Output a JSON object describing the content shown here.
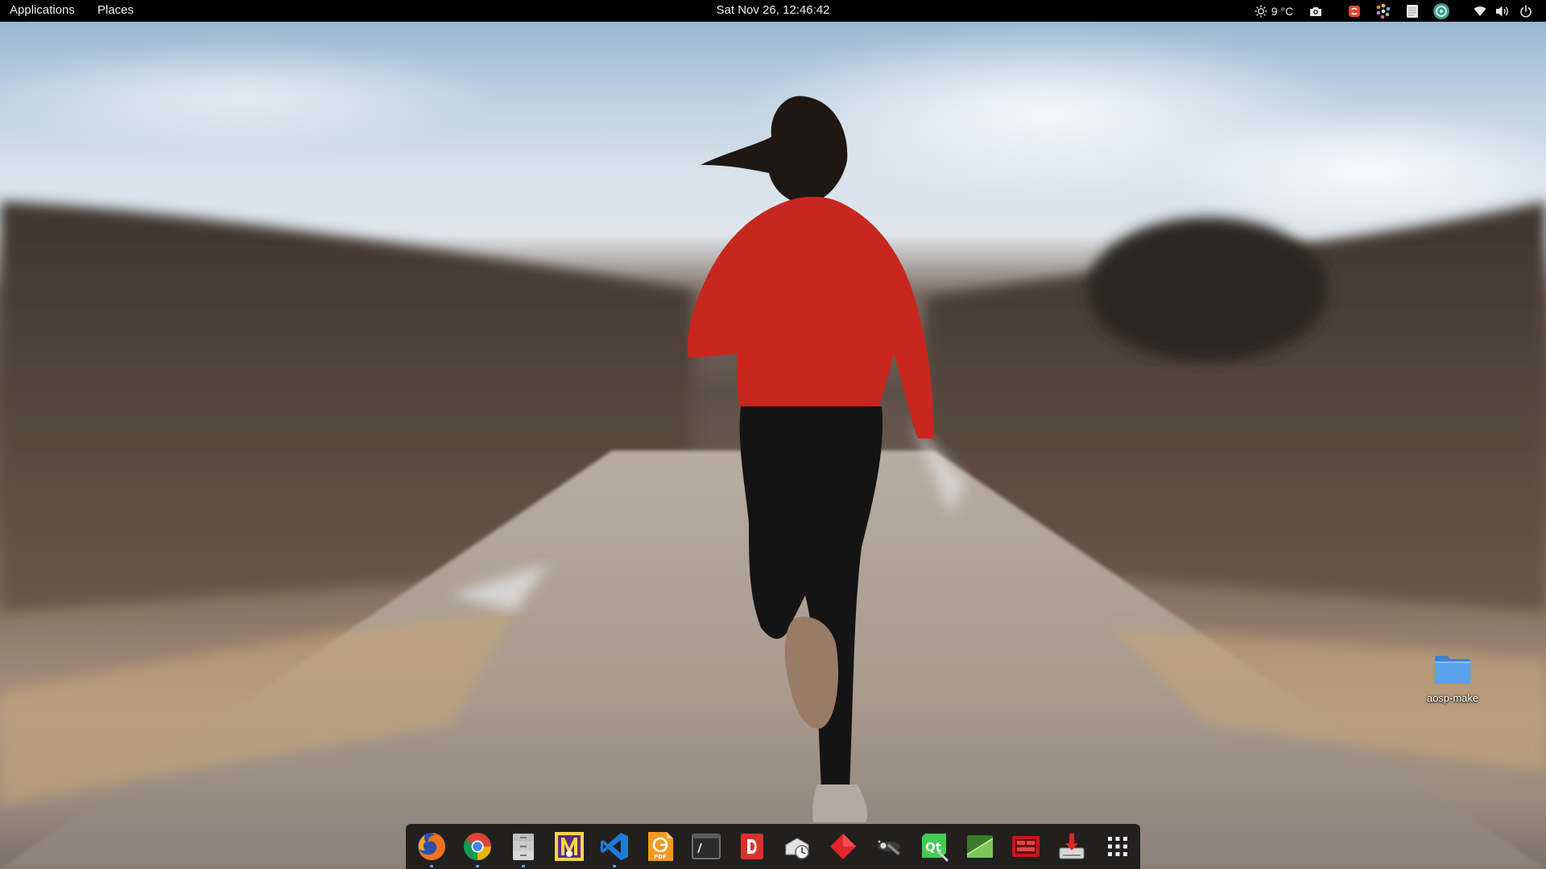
{
  "topbar": {
    "applications_label": "Applications",
    "places_label": "Places",
    "clock": "Sat Nov 26, 12:46:42",
    "weather": "9 °C"
  },
  "desktop": {
    "icons": [
      {
        "label": "aosp-make",
        "icon": "folder-icon"
      }
    ]
  },
  "dock": {
    "items": [
      {
        "name": "firefox",
        "icon": "firefox-icon",
        "running": true
      },
      {
        "name": "chrome",
        "icon": "chrome-icon",
        "running": true
      },
      {
        "name": "files",
        "icon": "files-icon",
        "running": true
      },
      {
        "name": "latex-editor",
        "icon": "latex-editor-icon",
        "running": false
      },
      {
        "name": "vscode",
        "icon": "vscode-icon",
        "running": true
      },
      {
        "name": "pdf-editor",
        "icon": "pdf-editor-icon",
        "running": false
      },
      {
        "name": "terminal",
        "icon": "terminal-icon",
        "running": false
      },
      {
        "name": "dict",
        "icon": "dict-icon",
        "running": false
      },
      {
        "name": "disk-usage",
        "icon": "disk-usage-icon",
        "running": false
      },
      {
        "name": "git-gui",
        "icon": "diamond-app-icon",
        "running": false
      },
      {
        "name": "tweak-tool",
        "icon": "tweak-tool-icon",
        "running": false
      },
      {
        "name": "qt-creator",
        "icon": "qt-creator-icon",
        "running": false
      },
      {
        "name": "system-monitor",
        "icon": "system-monitor-icon",
        "running": false
      },
      {
        "name": "presenter",
        "icon": "presenter-icon",
        "running": false
      },
      {
        "name": "installer",
        "icon": "installer-icon",
        "running": false
      },
      {
        "name": "show-applications",
        "icon": "app-grid-icon",
        "running": false
      }
    ]
  },
  "colors": {
    "topbar_bg": "#000000",
    "dock_bg": "#121212",
    "running_indicator": "#5fa8ff",
    "folder_blue": "#4a90e2"
  }
}
